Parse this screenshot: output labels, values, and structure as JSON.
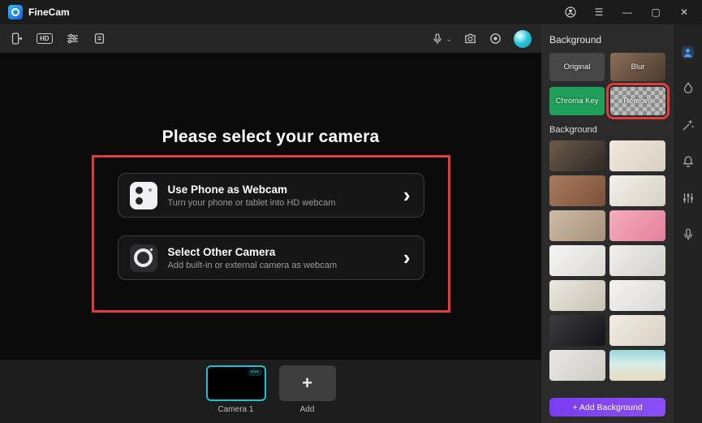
{
  "titlebar": {
    "app_name": "FineCam",
    "menu_glyph": "☰",
    "minimize_glyph": "—",
    "maximize_glyph": "▢",
    "close_glyph": "✕"
  },
  "toolbar": {
    "hd_label": "HD",
    "mic_dropdown_glyph": "⌄"
  },
  "preview": {
    "heading": "Please select your camera",
    "options": [
      {
        "title": "Use Phone as Webcam",
        "subtitle": "Turn your phone or tablet into HD webcam",
        "chevron": "›"
      },
      {
        "title": "Select Other Camera",
        "subtitle": "Add built-in or external camera as webcam",
        "chevron": "›"
      }
    ]
  },
  "filmstrip": {
    "camera": {
      "label": "Camera 1",
      "badge": "•••"
    },
    "add": {
      "glyph": "+",
      "label": "Add"
    }
  },
  "panel": {
    "title": "Background",
    "modes": [
      {
        "label": "Original",
        "css": "background:#474747"
      },
      {
        "label": "Blur",
        "css": "background:linear-gradient(135deg,#8a6f57,#4b3b2e)"
      },
      {
        "label": "Chroma Key",
        "css": "background:#1fa05a"
      },
      {
        "label": "Remove",
        "css": "background:repeating-conic-gradient(#bcbcbc 0% 25%, #8d8d8d 0% 50%) 0 0/10px 10px"
      }
    ],
    "section_title": "Background",
    "thumbs": [
      {
        "name": "desk-by-window",
        "css": "background:linear-gradient(135deg,#6e5c49,#2c2824)"
      },
      {
        "name": "cream-wall",
        "css": "background:linear-gradient(135deg,#efe9de,#d7cfc0)"
      },
      {
        "name": "brick-wall",
        "css": "background:linear-gradient(135deg,#a87c5f,#7b5138)"
      },
      {
        "name": "white-brick-plants",
        "css": "background:linear-gradient(135deg,#f3f0ea,#d6d1c4)"
      },
      {
        "name": "photo-collage-wall",
        "css": "background:linear-gradient(135deg,#cdbba6,#a8927a)"
      },
      {
        "name": "pink-flowers",
        "css": "background:linear-gradient(135deg,#f4aebd,#e57f9d)"
      },
      {
        "name": "white-shelf",
        "css": "background:linear-gradient(135deg,#f6f5f3,#dad8d4)"
      },
      {
        "name": "bright-interior",
        "css": "background:linear-gradient(135deg,#f0efec,#d2d0cb)"
      },
      {
        "name": "plant-room",
        "css": "background:linear-gradient(135deg,#ebe8e1,#c6c1b4)"
      },
      {
        "name": "white-desk-room",
        "css": "background:linear-gradient(135deg,#f4f3f1,#d9d9d7)"
      },
      {
        "name": "dark-doorway",
        "css": "background:linear-gradient(135deg,#3c3c40,#141417)"
      },
      {
        "name": "bedroom",
        "css": "background:linear-gradient(135deg,#f2ede5,#d6d0c3)"
      },
      {
        "name": "gray-wall",
        "css": "background:linear-gradient(135deg,#eae8e5,#cecbc6)"
      },
      {
        "name": "beach",
        "css": "background:linear-gradient(180deg,#9ad6da 0%,#d8ecea 45%,#e9d9b9 100%)"
      }
    ],
    "add_button_label": "+ Add Background"
  },
  "colors": {
    "accent_teal": "#1cc2d4",
    "annotation_red": "#e23b3b",
    "chroma_green": "#1fa05a",
    "add_button_purple": "#7a3df0"
  }
}
